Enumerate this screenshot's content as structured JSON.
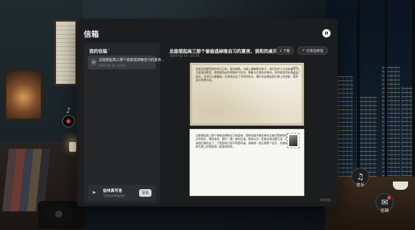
{
  "modal": {
    "title": "信箱",
    "avatar_letter": "H"
  },
  "left": {
    "heading": "我的信箱",
    "count": "1",
    "items": [
      {
        "title": "总能想起高三那个偷偷逃掉晚自习的夏夜...",
        "date": "2025-02-14 · 22:15"
      }
    ],
    "write": {
      "title": "给林真写信",
      "subtitle": "写完这封等她回信",
      "button": "写信"
    }
  },
  "right": {
    "title": "总能想起高三那个偷偷逃掉晚自习的夏夜，我和同桌开着...",
    "date": "2025-02-14 · 22:15",
    "download": "下载",
    "share": "分享这封信",
    "footer": "林的回信",
    "letter_top": "夏夜总会翻到那年的日记本，窗外蝉鸣，书桌上摊着数学卷子。我们约好十点半趁老师不注意溜出教室，跑到操场边的梧桐树下吹风，聊着以后想去的城市。那时候觉得未来很长很长，长到可以慢慢来。后来各自去了不同的地方，偶尔还会想起那天晚上的星星，和你说过的那句话。",
    "letter_bottom": "总能想起高三那个偷偷逃掉晚自习的夏夜，我和同桌开着旧单车沿着河堤骑到很远的地方。晚风很凉，路灯一盏一盏向后退，她说以后一定要去海边看日出。后来我们真的去了，只是那时已经不再是同桌。谢谢你一直记得那个夏天，也谢谢那天晚上愿意陪我一起冒险的你。"
  },
  "widgets": {
    "music_label": "音乐",
    "mail_label": "信箱"
  }
}
